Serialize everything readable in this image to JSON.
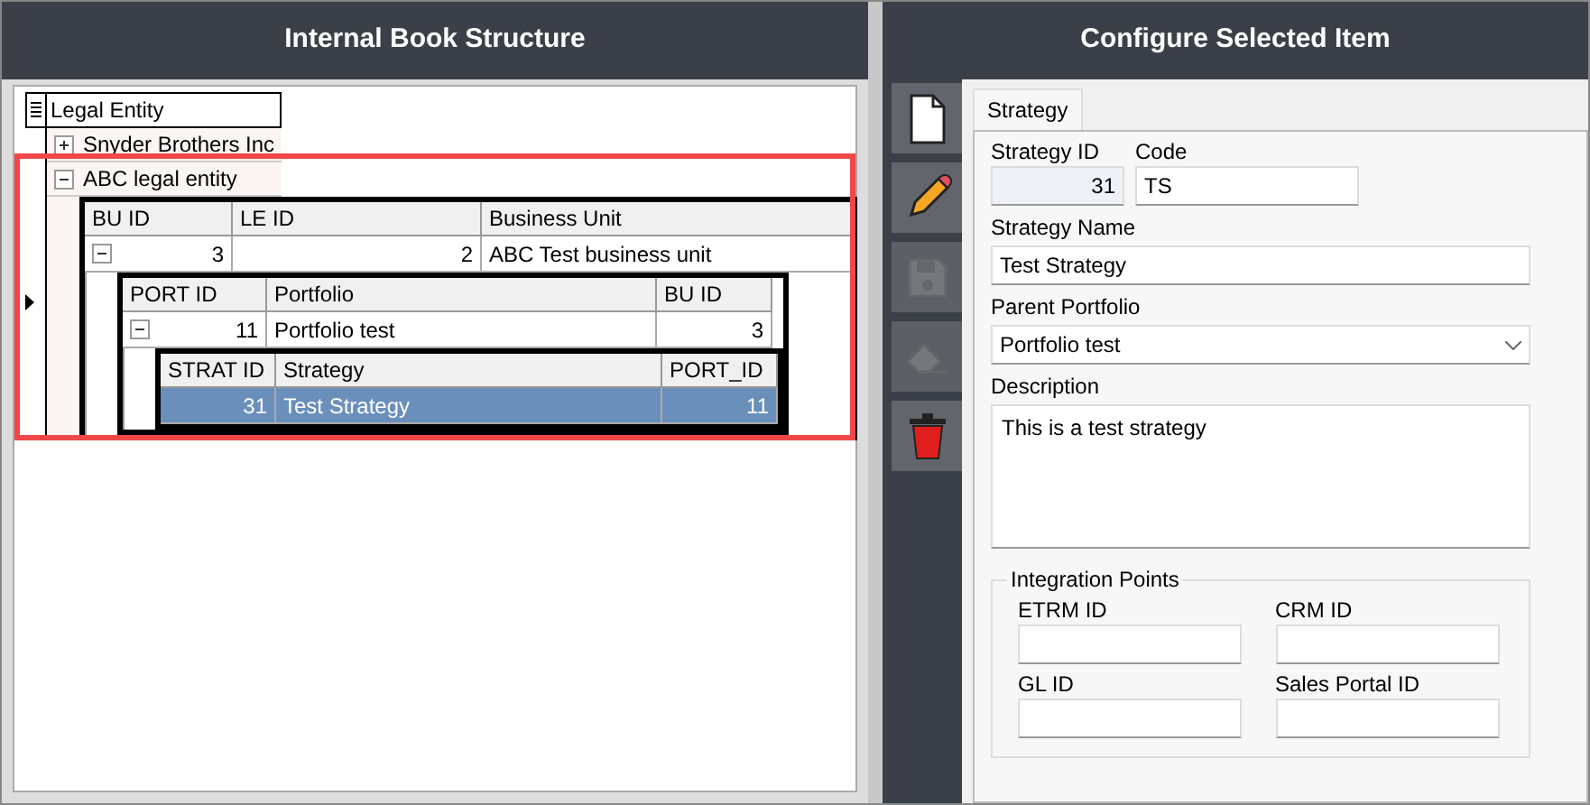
{
  "left_panel": {
    "title": "Internal Book Structure",
    "grid": {
      "column": "Legal Entity",
      "rows": [
        {
          "label": "Snyder Brothers Inc",
          "expanded": false
        },
        {
          "label": "ABC legal entity",
          "expanded": true,
          "current": true,
          "child": {
            "columns": [
              {
                "label": "BU ID",
                "kind": "number"
              },
              {
                "label": "LE ID",
                "kind": "number"
              },
              {
                "label": "Business Unit",
                "kind": "text"
              }
            ],
            "rows": [
              {
                "cells": [
                  "3",
                  "2",
                  "ABC Test business unit"
                ],
                "expanded": true,
                "selected": false,
                "child": {
                  "columns": [
                    {
                      "label": "PORT ID",
                      "kind": "number"
                    },
                    {
                      "label": "Portfolio",
                      "kind": "text"
                    },
                    {
                      "label": "BU ID",
                      "kind": "number"
                    }
                  ],
                  "rows": [
                    {
                      "cells": [
                        "11",
                        "Portfolio test",
                        "3"
                      ],
                      "expanded": true,
                      "selected": false,
                      "child": {
                        "columns": [
                          {
                            "label": "STRAT ID",
                            "kind": "number"
                          },
                          {
                            "label": "Strategy",
                            "kind": "text"
                          },
                          {
                            "label": "PORT_ID",
                            "kind": "number"
                          }
                        ],
                        "rows": [
                          {
                            "cells": [
                              "31",
                              "Test Strategy",
                              "11"
                            ],
                            "selected": true
                          }
                        ]
                      }
                    }
                  ]
                }
              }
            ]
          }
        }
      ]
    }
  },
  "right_panel": {
    "title": "Configure Selected Item",
    "toolbar": [
      {
        "kind": "new",
        "disabled": false
      },
      {
        "kind": "edit",
        "disabled": false
      },
      {
        "kind": "save",
        "disabled": true
      },
      {
        "kind": "clear",
        "disabled": true
      },
      {
        "kind": "delete",
        "disabled": false
      }
    ],
    "tabs": [
      {
        "label": "Strategy",
        "selected": true
      }
    ],
    "form": {
      "strategy_id": {
        "label": "Strategy ID",
        "value": "31"
      },
      "code": {
        "label": "Code",
        "value": "TS"
      },
      "strategy_name": {
        "label": "Strategy Name",
        "value": "Test Strategy"
      },
      "parent_portfolio": {
        "label": "Parent Portfolio",
        "value": "Portfolio test"
      },
      "description": {
        "label": "Description",
        "value": "This is a test strategy"
      },
      "integration_points": {
        "title": "Integration Points",
        "fields": [
          {
            "label": "ETRM ID"
          },
          {
            "label": "CRM ID"
          },
          {
            "label": "GL ID"
          },
          {
            "label": "Sales Portal ID"
          }
        ]
      }
    }
  }
}
